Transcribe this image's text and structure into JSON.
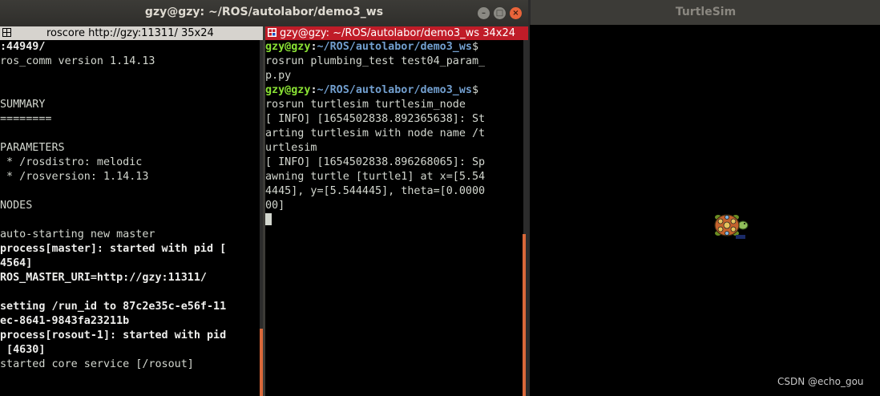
{
  "terminal": {
    "title": "gzy@gzy: ~/ROS/autolabor/demo3_ws",
    "pane1": {
      "header": "roscore http://gzy:11311/ 35x24",
      "lines": [
        {
          "t": ":44949/",
          "bold": true
        },
        {
          "t": "ros_comm version 1.14.13",
          "bold": false
        },
        {
          "t": "",
          "bold": false
        },
        {
          "t": "",
          "bold": false
        },
        {
          "t": "SUMMARY",
          "bold": false
        },
        {
          "t": "========",
          "bold": false
        },
        {
          "t": "",
          "bold": false
        },
        {
          "t": "PARAMETERS",
          "bold": false
        },
        {
          "t": " * /rosdistro: melodic",
          "bold": false
        },
        {
          "t": " * /rosversion: 1.14.13",
          "bold": false
        },
        {
          "t": "",
          "bold": false
        },
        {
          "t": "NODES",
          "bold": false
        },
        {
          "t": "",
          "bold": false
        },
        {
          "t": "auto-starting new master",
          "bold": false
        },
        {
          "t": "process[master]: started with pid [",
          "bold": true
        },
        {
          "t": "4564]",
          "bold": true
        },
        {
          "t": "ROS_MASTER_URI=http://gzy:11311/",
          "bold": true
        },
        {
          "t": "",
          "bold": false
        },
        {
          "t": "setting /run_id to 87c2e35c-e56f-11",
          "bold": true
        },
        {
          "t": "ec-8641-9843fa23211b",
          "bold": true
        },
        {
          "t": "process[rosout-1]: started with pid",
          "bold": true
        },
        {
          "t": " [4630]",
          "bold": true
        },
        {
          "t": "started core service [/rosout]",
          "bold": false
        }
      ]
    },
    "pane2": {
      "header": "gzy@gzy: ~/ROS/autolabor/demo3_ws 34x24",
      "prompt_user": "gzy@gzy",
      "prompt_path": "~/ROS/autolabor/demo3_ws",
      "prompt_suffix": "$",
      "cmd1": [
        "rosrun plumbing_test test04_param_",
        "p.py"
      ],
      "cmd2": "rosrun turtlesim turtlesim_node",
      "output": [
        "[ INFO] [1654502838.892365638]: St",
        "arting turtlesim with node name /t",
        "urtlesim",
        "[ INFO] [1654502838.896268065]: Sp",
        "awning turtle [turtle1] at x=[5.54",
        "4445], y=[5.544445], theta=[0.0000",
        "00]"
      ]
    }
  },
  "turtlesim": {
    "title": "TurtleSim",
    "background": "#000000"
  },
  "watermark": "CSDN @echo_gou",
  "colors": {
    "accent_orange": "#e9643a",
    "pane_active": "#c01c28",
    "prompt_green": "#8ae234",
    "prompt_blue": "#729fcf"
  }
}
